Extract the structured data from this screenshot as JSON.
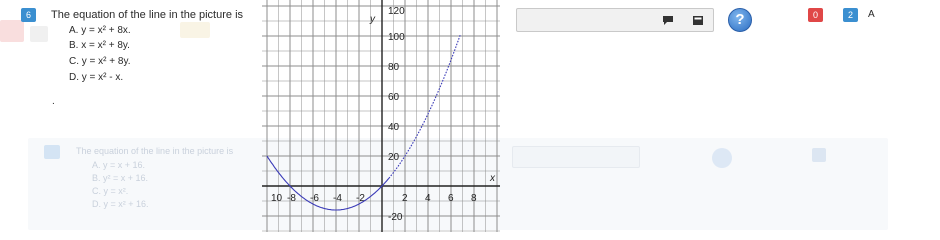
{
  "question": {
    "number": "6",
    "text": "The equation of the line in the picture is",
    "options": [
      "A. y = x² + 8x.",
      "B. x = x² + 8y.",
      "C. y = x² + 8y.",
      "D. y = x² - x."
    ],
    "trailing_mark": "."
  },
  "answer": {
    "value": "",
    "comment_icon": "comment-icon",
    "calculator_icon": "calculator-icon"
  },
  "help": {
    "label": "?",
    "icon": "help-icon"
  },
  "status": {
    "wrong_count": "0",
    "right_count": "2",
    "letter": "A"
  },
  "graph": {
    "x_label": "x",
    "y_label": "y",
    "x_ticks": [
      "10",
      "-8",
      "-6",
      "-4",
      "-2",
      "2",
      "4",
      "6",
      "8"
    ],
    "y_ticks": [
      "120",
      "100",
      "80",
      "60",
      "40",
      "20",
      "-20"
    ]
  },
  "ghost": {
    "text": "The equation of the line in the picture is",
    "options": [
      "A. y = x + 16.",
      "B. y² = x + 16.",
      "C. y = x².",
      "D. y = x² + 16."
    ]
  },
  "colors": {
    "accent": "#3b8fd0",
    "curve": "#3b3bb8",
    "wrong": "#e04747",
    "right": "#3b8fd0"
  }
}
